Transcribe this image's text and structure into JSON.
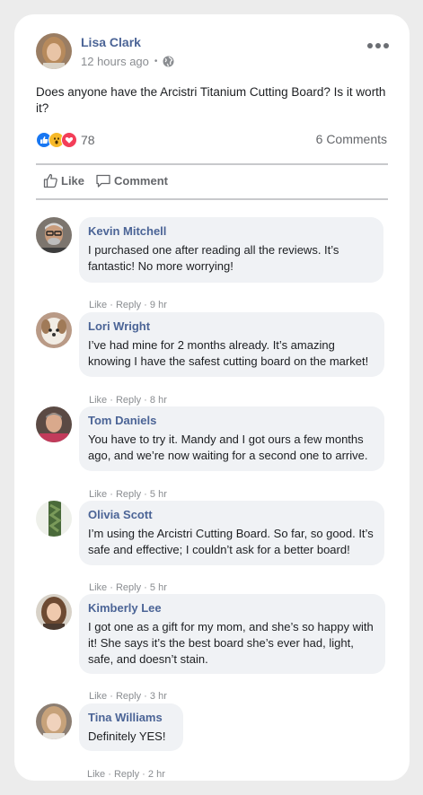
{
  "post": {
    "author": "Lisa Clark",
    "time": "12 hours ago",
    "separator": "•",
    "text": "Does anyone have the Arcistri Titanium Cutting Board? Is it worth it?",
    "reaction_count": "78",
    "comments_count": "6 Comments",
    "like_label": "Like",
    "comment_label": "Comment"
  },
  "colors": {
    "name": "#4b6496",
    "like_blue": "#1877f2",
    "wow_yellow": "#f7b928",
    "love_red": "#f33e58"
  },
  "comments": [
    {
      "name": "Kevin Mitchell",
      "text": "I purchased one after reading all the reviews. It’s fantastic! No more worrying!",
      "like": "Like",
      "reply": "Reply",
      "sep": "·",
      "time": "9 hr"
    },
    {
      "name": "Lori Wright",
      "text": "I’ve had mine for 2 months already. It’s amazing knowing I have the safest cutting board on the market!",
      "like": "Like",
      "reply": "Reply",
      "sep": "·",
      "time": "8 hr"
    },
    {
      "name": "Tom Daniels",
      "text": "You have to try it. Mandy and I got ours a few months ago, and we’re now waiting for a second one to arrive.",
      "like": "Like",
      "reply": "Reply",
      "sep": "·",
      "time": "5 hr"
    },
    {
      "name": "Olivia Scott",
      "text": "I’m using the Arcistri Cutting Board. So far, so good. It’s safe and effective; I couldn’t ask for a better board!",
      "like": "Like",
      "reply": "Reply",
      "sep": "·",
      "time": "5 hr"
    },
    {
      "name": "Kimberly Lee",
      "text": "I got one as a gift for my mom, and she’s so happy with it! She says it’s the best board she’s ever had, light, safe, and doesn’t stain.",
      "like": "Like",
      "reply": "Reply",
      "sep": "·",
      "time": "3 hr"
    },
    {
      "name": "Tina Williams",
      "text": "Definitely YES!",
      "like": "Like",
      "reply": "Reply",
      "sep": "·",
      "time": "2 hr"
    }
  ]
}
